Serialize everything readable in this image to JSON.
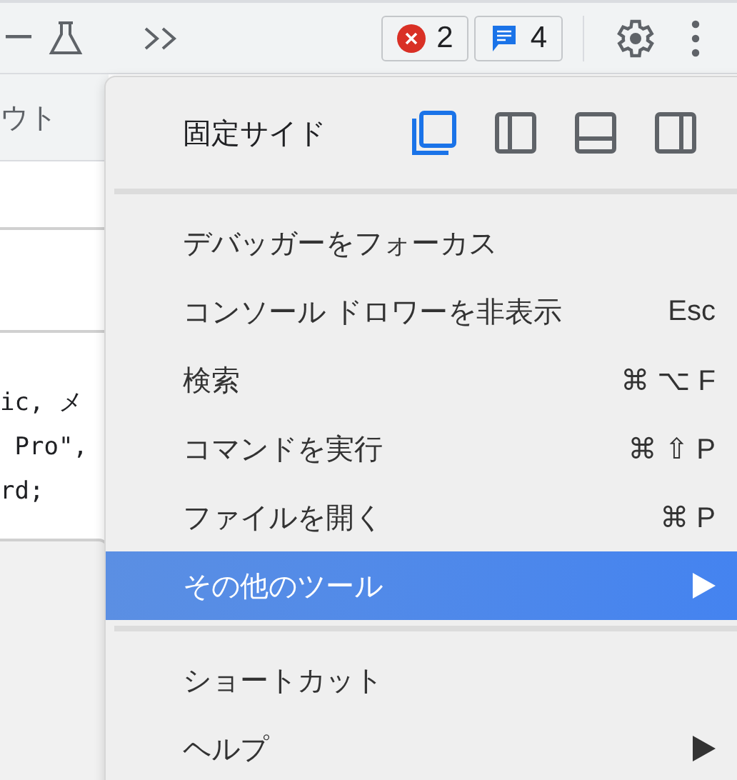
{
  "toolbar": {
    "cut_tab": "ー",
    "error_count": "2",
    "message_count": "4"
  },
  "left_panel": {
    "tab_label": "ウト",
    "code_lines": [
      "ic, メ",
      " Pro\",",
      "rd;"
    ]
  },
  "menu": {
    "dock_side": {
      "label": "固定サイド",
      "options": [
        {
          "kind": "undock",
          "selected": true
        },
        {
          "kind": "left",
          "selected": false
        },
        {
          "kind": "bottom",
          "selected": false
        },
        {
          "kind": "right",
          "selected": false
        }
      ]
    },
    "sections": [
      {
        "items": [
          {
            "label": "デバッガーをフォーカス",
            "submenu": false,
            "selected": false
          },
          {
            "label": "コンソール ドロワーを非表示",
            "shortcut": "Esc",
            "submenu": false,
            "selected": false
          },
          {
            "label": "検索",
            "shortcut": "⌘ ⌥ F",
            "submenu": false,
            "selected": false
          },
          {
            "label": "コマンドを実行",
            "shortcut": "⌘ ⇧ P",
            "submenu": false,
            "selected": false
          },
          {
            "label": "ファイルを開く",
            "shortcut": "⌘ P",
            "submenu": false,
            "selected": false
          },
          {
            "label": "その他のツール",
            "submenu": true,
            "selected": true
          }
        ]
      },
      {
        "items": [
          {
            "label": "ショートカット",
            "submenu": false,
            "selected": false
          },
          {
            "label": "ヘルプ",
            "submenu": true,
            "selected": false
          }
        ]
      }
    ]
  }
}
